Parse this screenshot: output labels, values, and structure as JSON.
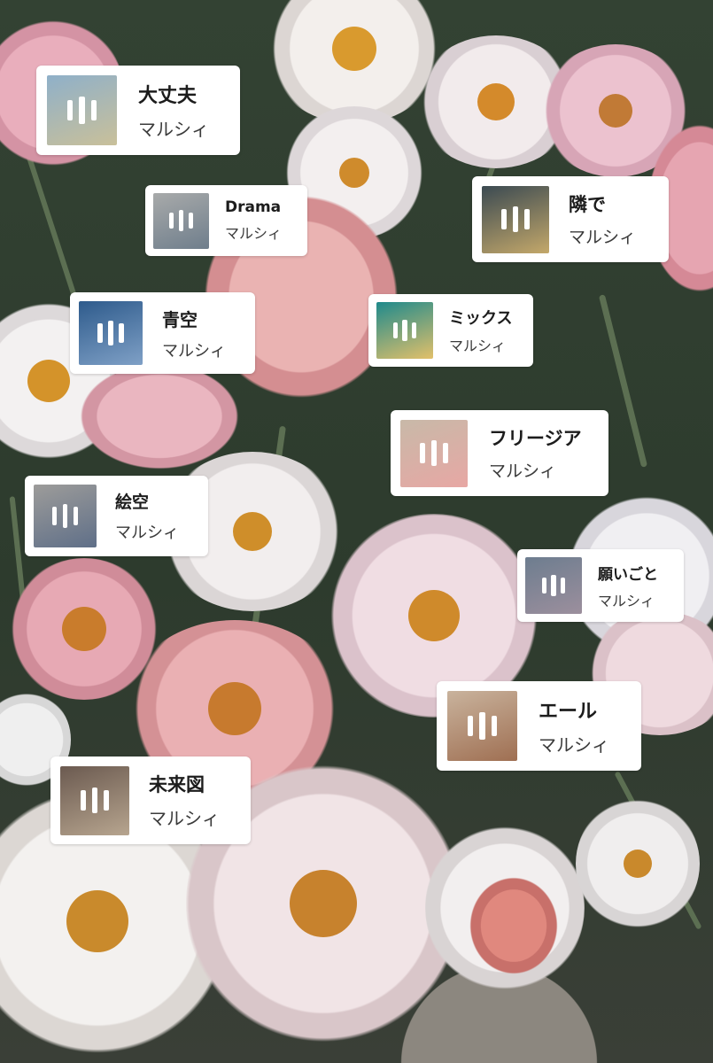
{
  "cards": [
    {
      "id": "daijoubu",
      "title": "大丈夫",
      "artist": "マルシィ",
      "cover_colors": [
        "#8fb0c9",
        "#c9c09a"
      ]
    },
    {
      "id": "drama",
      "title": "Drama",
      "artist": "マルシィ",
      "cover_colors": [
        "#a8aaaa",
        "#6f7e8c"
      ]
    },
    {
      "id": "tonaride",
      "title": "隣で",
      "artist": "マルシィ",
      "cover_colors": [
        "#3b4a52",
        "#c4a86a"
      ]
    },
    {
      "id": "aozora",
      "title": "青空",
      "artist": "マルシィ",
      "cover_colors": [
        "#2e5b8c",
        "#7fa0c6"
      ]
    },
    {
      "id": "mix",
      "title": "ミックス",
      "artist": "マルシィ",
      "cover_colors": [
        "#1f8a8c",
        "#e2c06a"
      ]
    },
    {
      "id": "freesia",
      "title": "フリージア",
      "artist": "マルシィ",
      "cover_colors": [
        "#c8b9a8",
        "#e7a7a4"
      ]
    },
    {
      "id": "ezora",
      "title": "絵空",
      "artist": "マルシィ",
      "cover_colors": [
        "#9d9c9a",
        "#5f6f88"
      ]
    },
    {
      "id": "negaigoto",
      "title": "願いごと",
      "artist": "マルシィ",
      "cover_colors": [
        "#6d7d8f",
        "#9c8f9d"
      ]
    },
    {
      "id": "yell",
      "title": "エール",
      "artist": "マルシィ",
      "cover_colors": [
        "#c9b39d",
        "#9f6f52"
      ]
    },
    {
      "id": "miraizu",
      "title": "未来図",
      "artist": "マルシィ",
      "cover_colors": [
        "#6b5a50",
        "#b7a58f"
      ]
    }
  ]
}
